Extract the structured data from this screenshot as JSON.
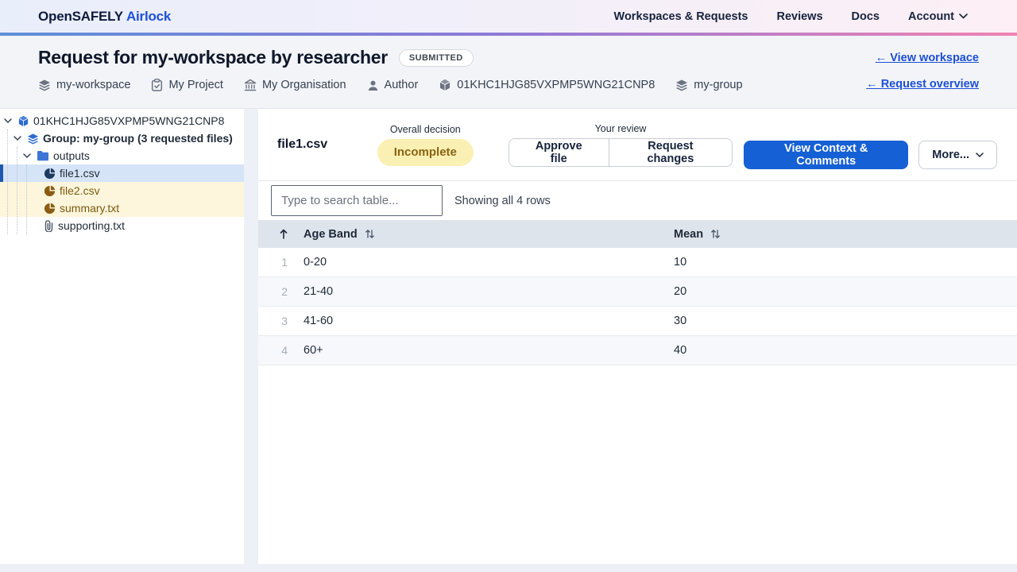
{
  "brand": {
    "primary": "OpenSAFELY",
    "secondary": "Airlock"
  },
  "nav": {
    "items": [
      "Workspaces & Requests",
      "Reviews",
      "Docs"
    ],
    "account_label": "Account"
  },
  "request_header": {
    "title": "Request for my-workspace by researcher",
    "status_badge": "SUBMITTED",
    "meta": [
      {
        "icon": "layers-icon",
        "label": "my-workspace"
      },
      {
        "icon": "clipboard-icon",
        "label": "My Project"
      },
      {
        "icon": "organisation-icon",
        "label": "My Organisation"
      },
      {
        "icon": "user-icon",
        "label": "Author"
      },
      {
        "icon": "package-icon",
        "label": "01KHC1HJG85VXPMP5WNG21CNP8"
      },
      {
        "icon": "layers-icon",
        "label": "my-group"
      }
    ],
    "links": [
      {
        "label": "← View workspace"
      },
      {
        "label": "← Request overview"
      }
    ]
  },
  "file_tree": {
    "root": {
      "label": "01KHC1HJG85VXPMP5WNG21CNP8"
    },
    "group": {
      "label": "Group: my-group (3 requested files)"
    },
    "folder": {
      "label": "outputs"
    },
    "files": [
      {
        "label": "file1.csv",
        "state": "selected"
      },
      {
        "label": "file2.csv",
        "state": "flagged"
      },
      {
        "label": "summary.txt",
        "state": "flagged"
      },
      {
        "label": "supporting.txt",
        "state": "supporting"
      }
    ]
  },
  "file_view": {
    "file_name": "file1.csv",
    "overall_decision_label": "Overall decision",
    "decision_value": "Incomplete",
    "your_review_label": "Your review",
    "approve_button": "Approve file",
    "request_changes_button": "Request changes",
    "context_button": "View Context & Comments",
    "more_button": "More...",
    "search_placeholder": "Type to search table...",
    "row_count_text": "Showing all 4 rows"
  },
  "table": {
    "columns": [
      "Age Band",
      "Mean"
    ],
    "rows": [
      {
        "index": "1",
        "age_band": "0-20",
        "mean": "10"
      },
      {
        "index": "2",
        "age_band": "21-40",
        "mean": "20"
      },
      {
        "index": "3",
        "age_band": "41-60",
        "mean": "30"
      },
      {
        "index": "4",
        "age_band": "60+",
        "mean": "40"
      }
    ]
  },
  "colors": {
    "accent_blue": "#1560d4",
    "link_blue": "#1d4fd7",
    "gradient_bar": [
      "#5d8fd6",
      "#8f7ad6",
      "#f083b1"
    ],
    "decision_pill_bg": "#faf0b3",
    "decision_pill_text": "#8a6414",
    "selected_row_bg": "#d6e4f8",
    "flagged_row_bg": "#fdf6dc",
    "table_header_bg": "#dee4ec"
  }
}
